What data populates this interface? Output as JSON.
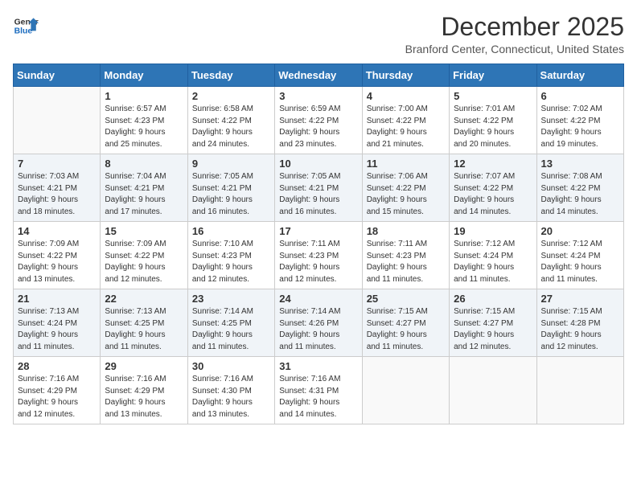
{
  "header": {
    "logo_line1": "General",
    "logo_line2": "Blue",
    "title": "December 2025",
    "subtitle": "Branford Center, Connecticut, United States"
  },
  "days_of_week": [
    "Sunday",
    "Monday",
    "Tuesday",
    "Wednesday",
    "Thursday",
    "Friday",
    "Saturday"
  ],
  "weeks": [
    [
      {
        "day": "",
        "info": ""
      },
      {
        "day": "1",
        "info": "Sunrise: 6:57 AM\nSunset: 4:23 PM\nDaylight: 9 hours\nand 25 minutes."
      },
      {
        "day": "2",
        "info": "Sunrise: 6:58 AM\nSunset: 4:22 PM\nDaylight: 9 hours\nand 24 minutes."
      },
      {
        "day": "3",
        "info": "Sunrise: 6:59 AM\nSunset: 4:22 PM\nDaylight: 9 hours\nand 23 minutes."
      },
      {
        "day": "4",
        "info": "Sunrise: 7:00 AM\nSunset: 4:22 PM\nDaylight: 9 hours\nand 21 minutes."
      },
      {
        "day": "5",
        "info": "Sunrise: 7:01 AM\nSunset: 4:22 PM\nDaylight: 9 hours\nand 20 minutes."
      },
      {
        "day": "6",
        "info": "Sunrise: 7:02 AM\nSunset: 4:22 PM\nDaylight: 9 hours\nand 19 minutes."
      }
    ],
    [
      {
        "day": "7",
        "info": "Sunrise: 7:03 AM\nSunset: 4:21 PM\nDaylight: 9 hours\nand 18 minutes."
      },
      {
        "day": "8",
        "info": "Sunrise: 7:04 AM\nSunset: 4:21 PM\nDaylight: 9 hours\nand 17 minutes."
      },
      {
        "day": "9",
        "info": "Sunrise: 7:05 AM\nSunset: 4:21 PM\nDaylight: 9 hours\nand 16 minutes."
      },
      {
        "day": "10",
        "info": "Sunrise: 7:05 AM\nSunset: 4:21 PM\nDaylight: 9 hours\nand 16 minutes."
      },
      {
        "day": "11",
        "info": "Sunrise: 7:06 AM\nSunset: 4:22 PM\nDaylight: 9 hours\nand 15 minutes."
      },
      {
        "day": "12",
        "info": "Sunrise: 7:07 AM\nSunset: 4:22 PM\nDaylight: 9 hours\nand 14 minutes."
      },
      {
        "day": "13",
        "info": "Sunrise: 7:08 AM\nSunset: 4:22 PM\nDaylight: 9 hours\nand 14 minutes."
      }
    ],
    [
      {
        "day": "14",
        "info": "Sunrise: 7:09 AM\nSunset: 4:22 PM\nDaylight: 9 hours\nand 13 minutes."
      },
      {
        "day": "15",
        "info": "Sunrise: 7:09 AM\nSunset: 4:22 PM\nDaylight: 9 hours\nand 12 minutes."
      },
      {
        "day": "16",
        "info": "Sunrise: 7:10 AM\nSunset: 4:23 PM\nDaylight: 9 hours\nand 12 minutes."
      },
      {
        "day": "17",
        "info": "Sunrise: 7:11 AM\nSunset: 4:23 PM\nDaylight: 9 hours\nand 12 minutes."
      },
      {
        "day": "18",
        "info": "Sunrise: 7:11 AM\nSunset: 4:23 PM\nDaylight: 9 hours\nand 11 minutes."
      },
      {
        "day": "19",
        "info": "Sunrise: 7:12 AM\nSunset: 4:24 PM\nDaylight: 9 hours\nand 11 minutes."
      },
      {
        "day": "20",
        "info": "Sunrise: 7:12 AM\nSunset: 4:24 PM\nDaylight: 9 hours\nand 11 minutes."
      }
    ],
    [
      {
        "day": "21",
        "info": "Sunrise: 7:13 AM\nSunset: 4:24 PM\nDaylight: 9 hours\nand 11 minutes."
      },
      {
        "day": "22",
        "info": "Sunrise: 7:13 AM\nSunset: 4:25 PM\nDaylight: 9 hours\nand 11 minutes."
      },
      {
        "day": "23",
        "info": "Sunrise: 7:14 AM\nSunset: 4:25 PM\nDaylight: 9 hours\nand 11 minutes."
      },
      {
        "day": "24",
        "info": "Sunrise: 7:14 AM\nSunset: 4:26 PM\nDaylight: 9 hours\nand 11 minutes."
      },
      {
        "day": "25",
        "info": "Sunrise: 7:15 AM\nSunset: 4:27 PM\nDaylight: 9 hours\nand 11 minutes."
      },
      {
        "day": "26",
        "info": "Sunrise: 7:15 AM\nSunset: 4:27 PM\nDaylight: 9 hours\nand 12 minutes."
      },
      {
        "day": "27",
        "info": "Sunrise: 7:15 AM\nSunset: 4:28 PM\nDaylight: 9 hours\nand 12 minutes."
      }
    ],
    [
      {
        "day": "28",
        "info": "Sunrise: 7:16 AM\nSunset: 4:29 PM\nDaylight: 9 hours\nand 12 minutes."
      },
      {
        "day": "29",
        "info": "Sunrise: 7:16 AM\nSunset: 4:29 PM\nDaylight: 9 hours\nand 13 minutes."
      },
      {
        "day": "30",
        "info": "Sunrise: 7:16 AM\nSunset: 4:30 PM\nDaylight: 9 hours\nand 13 minutes."
      },
      {
        "day": "31",
        "info": "Sunrise: 7:16 AM\nSunset: 4:31 PM\nDaylight: 9 hours\nand 14 minutes."
      },
      {
        "day": "",
        "info": ""
      },
      {
        "day": "",
        "info": ""
      },
      {
        "day": "",
        "info": ""
      }
    ]
  ]
}
